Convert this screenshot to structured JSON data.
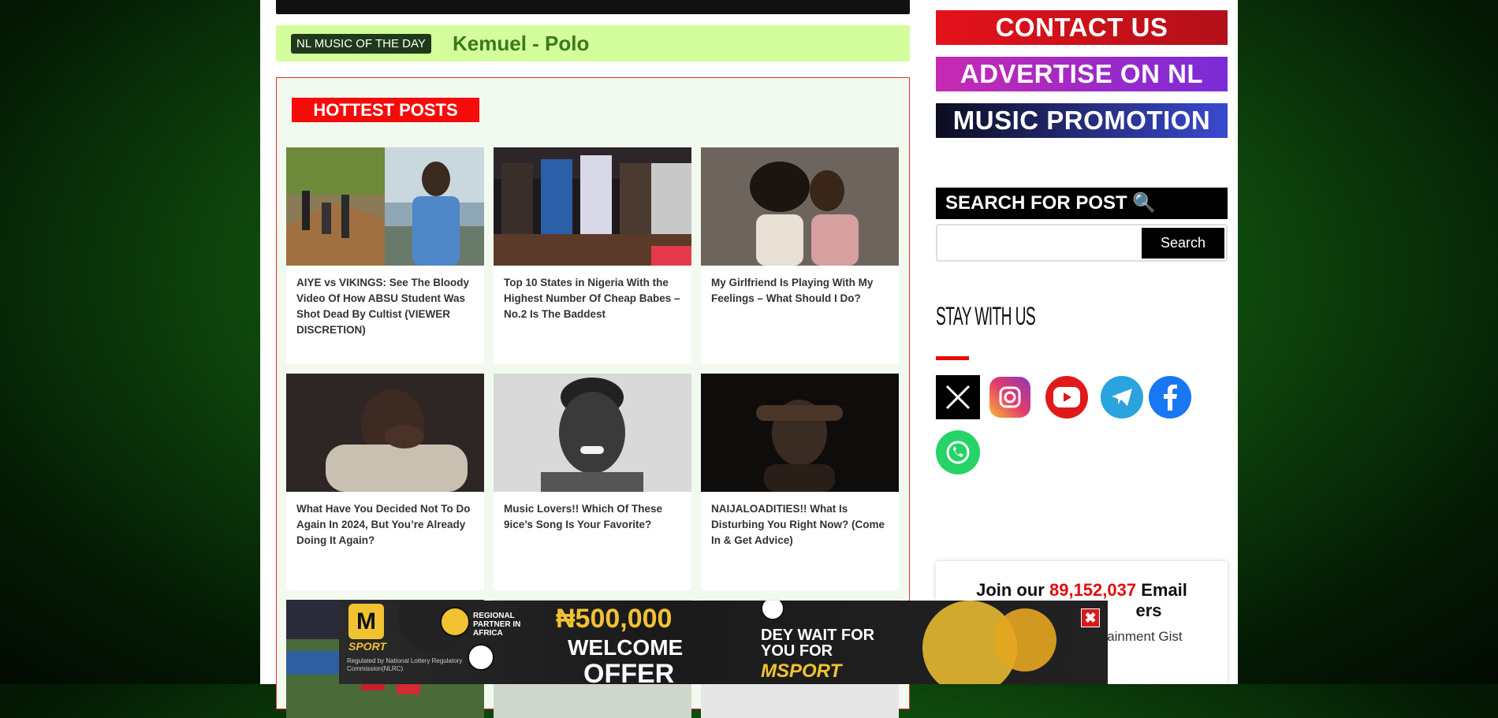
{
  "music_of_day": {
    "badge": "NL MUSIC OF THE DAY",
    "song": "Kemuel - Polo"
  },
  "hottest": {
    "title": "HOTTEST POSTS",
    "posts": [
      {
        "caption": "AIYE vs VIKINGS: See The Bloody Video Of How ABSU Student Was Shot Dead By Cultist (VIEWER DISCRETION)"
      },
      {
        "caption": "Top 10 States in Nigeria With the Highest Number Of Cheap Babes – No.2 Is The Baddest"
      },
      {
        "caption": "My Girlfriend Is Playing With My Feelings – What Should I Do?"
      },
      {
        "caption": "What Have You Decided Not To Do Again In 2024, But You’re Already Doing It Again?"
      },
      {
        "caption": "Music Lovers!! Which Of These 9ice’s Song Is Your Favorite?"
      },
      {
        "caption": "NAIJALOADITIES!! What Is Disturbing You Right Now? (Come In & Get Advice)"
      }
    ]
  },
  "sidebar": {
    "contact": "CONTACT US",
    "advertise": "ADVERTISE ON NL",
    "music_promo": "MUSIC PROMOTION",
    "search_title": "SEARCH FOR POST 🔍",
    "search_placeholder": "",
    "search_button": "Search",
    "stay_title": "STAY WITH US",
    "join_prefix": "Join our ",
    "join_count": "89,152,037",
    "join_suffix": " Email",
    "join_line2": "ers",
    "join_sub": "ertainment Gist"
  },
  "ad": {
    "brand": "SPORT",
    "partner": "REGIONAL PARTNER IN AFRICA",
    "regulated": "Regulated by National Lottery Regulatory Commission(NLRC)",
    "amount": "₦500,000",
    "welcome": "WELCOME",
    "offer": "OFFER",
    "tag1": "DEY WAIT FOR YOU FOR",
    "tag2": "MSPORT",
    "close": "✖"
  },
  "colors": {
    "accent_red": "#e30d0d",
    "music_bg": "#d4fd9b"
  }
}
